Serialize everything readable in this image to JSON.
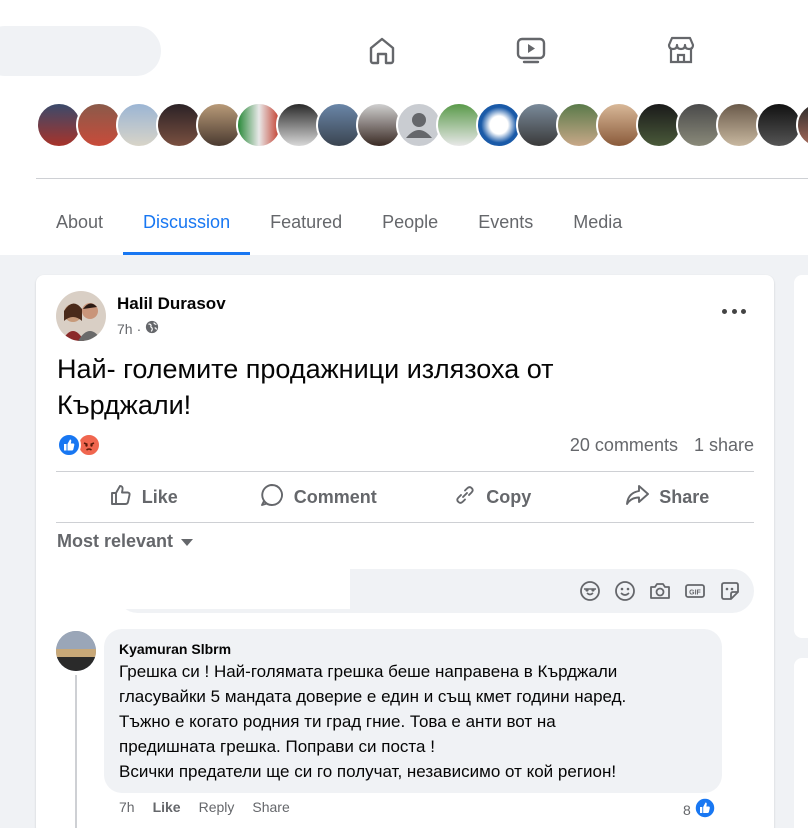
{
  "nav": {
    "icons": [
      "home-icon",
      "video-icon",
      "marketplace-icon"
    ]
  },
  "tabs": [
    {
      "label": "About",
      "active": false
    },
    {
      "label": "Discussion",
      "active": true
    },
    {
      "label": "Featured",
      "active": false
    },
    {
      "label": "People",
      "active": false
    },
    {
      "label": "Events",
      "active": false
    },
    {
      "label": "Media",
      "active": false
    }
  ],
  "post": {
    "author": "Halil Durasov",
    "time": "7h",
    "privacy_icon": "globe-icon",
    "text_line1": "Най- големите продажници излязоха от",
    "text_line2": "Кърджали!",
    "reactions": [
      "like-reaction-icon",
      "angry-reaction-icon"
    ],
    "comments_count": "20 comments",
    "shares_count": "1 share",
    "actions": {
      "like": "Like",
      "comment": "Comment",
      "copy": "Copy",
      "share": "Share"
    },
    "sort_label": "Most relevant"
  },
  "comment": {
    "author": "Kyamuran Slbrm",
    "lines": [
      "Грешка си ! Най-голямата грешка беше направена в Кърджали",
      "гласувайки 5 мандата доверие е един и същ кмет години наред.",
      "Тъжно е когато родния ти град гние. Това е анти вот на",
      "предишната грешка. Поправи си поста !",
      "Всички предатели ще си го получат, независимо от кой регион!"
    ],
    "time": "7h",
    "like": "Like",
    "reply": "Reply",
    "share": "Share",
    "likes_count": "8"
  },
  "colors": {
    "accent": "#1877f2",
    "muted": "#65676b",
    "angry": "#f0664f"
  }
}
